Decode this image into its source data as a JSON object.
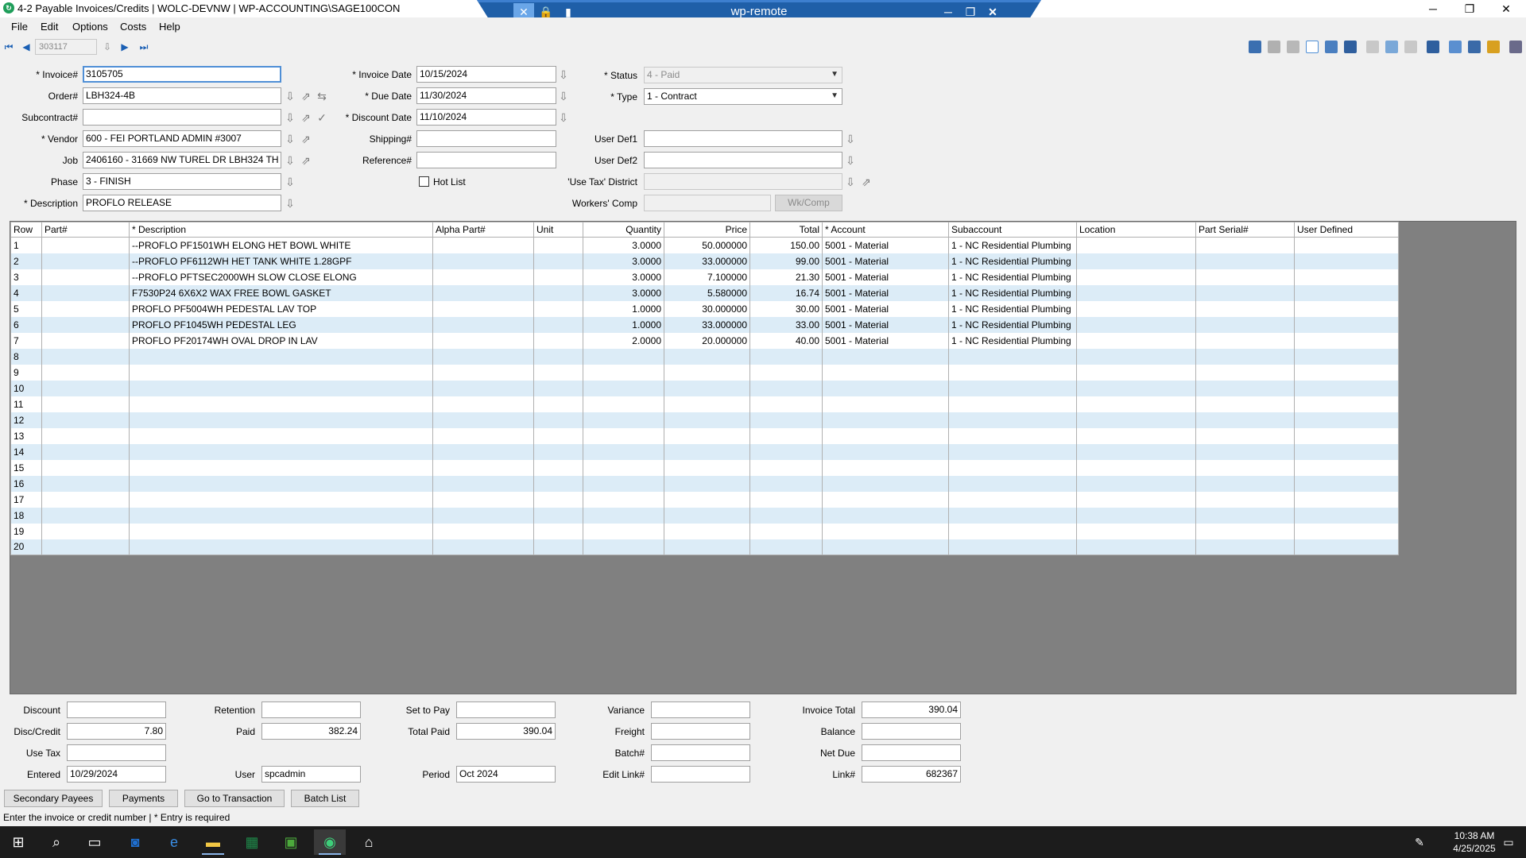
{
  "window": {
    "title": "4-2 Payable Invoices/Credits | WOLC-DEVNW | WP-ACCOUNTING\\SAGE100CON",
    "remote_title": "wp-remote"
  },
  "menu": {
    "file": "File",
    "edit": "Edit",
    "options": "Options",
    "costs": "Costs",
    "help": "Help"
  },
  "nav": {
    "record_number": "303117"
  },
  "form": {
    "invoice_label": "* Invoice#",
    "invoice_value": "3105705",
    "order_label": "Order#",
    "order_value": "LBH324-4B",
    "subcontract_label": "Subcontract#",
    "subcontract_value": "",
    "vendor_label": "* Vendor",
    "vendor_value": "600 - FEI PORTLAND ADMIN #3007",
    "job_label": "Job",
    "job_value": "2406160 - 31669 NW TUREL DR  LBH324 TH",
    "phase_label": "Phase",
    "phase_value": "3 - FINISH",
    "description_label": "* Description",
    "description_value": "PROFLO RELEASE",
    "invoice_date_label": "* Invoice Date",
    "invoice_date_value": "10/15/2024",
    "due_date_label": "* Due Date",
    "due_date_value": "11/30/2024",
    "discount_date_label": "* Discount Date",
    "discount_date_value": "11/10/2024",
    "shipping_label": "Shipping#",
    "shipping_value": "",
    "reference_label": "Reference#",
    "reference_value": "",
    "hot_list_label": "Hot List",
    "status_label": "* Status",
    "status_value": "4 - Paid",
    "type_label": "* Type",
    "type_value": "1 - Contract",
    "user_def1_label": "User Def1",
    "user_def1_value": "",
    "user_def2_label": "User Def2",
    "user_def2_value": "",
    "use_tax_district_label": "'Use Tax' District",
    "use_tax_district_value": "",
    "workers_comp_label": "Workers' Comp",
    "workers_comp_value": "",
    "wk_comp_button": "Wk/Comp"
  },
  "grid": {
    "headers": [
      "Row",
      "Part#",
      "* Description",
      "Alpha Part#",
      "Unit",
      "Quantity",
      "Price",
      "Total",
      "* Account",
      "Subaccount",
      "Location",
      "Part Serial#",
      "User Defined"
    ],
    "rows": [
      [
        "1",
        "",
        "--PROFLO PF1501WH ELONG HET BOWL WHITE",
        "",
        "",
        "3.0000",
        "50.000000",
        "150.00",
        "5001 - Material",
        "1 - NC Residential Plumbing",
        "",
        "",
        ""
      ],
      [
        "2",
        "",
        "--PROFLO PF6112WH HET TANK WHITE 1.28GPF",
        "",
        "",
        "3.0000",
        "33.000000",
        "99.00",
        "5001 - Material",
        "1 - NC Residential Plumbing",
        "",
        "",
        ""
      ],
      [
        "3",
        "",
        "--PROFLO PFTSEC2000WH SLOW CLOSE ELONG",
        "",
        "",
        "3.0000",
        "7.100000",
        "21.30",
        "5001 - Material",
        "1 - NC Residential Plumbing",
        "",
        "",
        ""
      ],
      [
        "4",
        "",
        "F7530P24 6X6X2 WAX FREE BOWL GASKET",
        "",
        "",
        "3.0000",
        "5.580000",
        "16.74",
        "5001 - Material",
        "1 - NC Residential Plumbing",
        "",
        "",
        ""
      ],
      [
        "5",
        "",
        "PROFLO PF5004WH PEDESTAL LAV TOP",
        "",
        "",
        "1.0000",
        "30.000000",
        "30.00",
        "5001 - Material",
        "1 - NC Residential Plumbing",
        "",
        "",
        ""
      ],
      [
        "6",
        "",
        "PROFLO PF1045WH PEDESTAL LEG",
        "",
        "",
        "1.0000",
        "33.000000",
        "33.00",
        "5001 - Material",
        "1 - NC Residential Plumbing",
        "",
        "",
        ""
      ],
      [
        "7",
        "",
        "PROFLO PF20174WH OVAL DROP IN LAV",
        "",
        "",
        "2.0000",
        "20.000000",
        "40.00",
        "5001 - Material",
        "1 - NC Residential Plumbing",
        "",
        "",
        ""
      ],
      [
        "8",
        "",
        "",
        "",
        "",
        "",
        "",
        "",
        "",
        "",
        "",
        "",
        ""
      ],
      [
        "9",
        "",
        "",
        "",
        "",
        "",
        "",
        "",
        "",
        "",
        "",
        "",
        ""
      ],
      [
        "10",
        "",
        "",
        "",
        "",
        "",
        "",
        "",
        "",
        "",
        "",
        "",
        ""
      ],
      [
        "11",
        "",
        "",
        "",
        "",
        "",
        "",
        "",
        "",
        "",
        "",
        "",
        ""
      ],
      [
        "12",
        "",
        "",
        "",
        "",
        "",
        "",
        "",
        "",
        "",
        "",
        "",
        ""
      ],
      [
        "13",
        "",
        "",
        "",
        "",
        "",
        "",
        "",
        "",
        "",
        "",
        "",
        ""
      ],
      [
        "14",
        "",
        "",
        "",
        "",
        "",
        "",
        "",
        "",
        "",
        "",
        "",
        ""
      ],
      [
        "15",
        "",
        "",
        "",
        "",
        "",
        "",
        "",
        "",
        "",
        "",
        "",
        ""
      ],
      [
        "16",
        "",
        "",
        "",
        "",
        "",
        "",
        "",
        "",
        "",
        "",
        "",
        ""
      ],
      [
        "17",
        "",
        "",
        "",
        "",
        "",
        "",
        "",
        "",
        "",
        "",
        "",
        ""
      ],
      [
        "18",
        "",
        "",
        "",
        "",
        "",
        "",
        "",
        "",
        "",
        "",
        "",
        ""
      ],
      [
        "19",
        "",
        "",
        "",
        "",
        "",
        "",
        "",
        "",
        "",
        "",
        "",
        ""
      ],
      [
        "20",
        "",
        "",
        "",
        "",
        "",
        "",
        "",
        "",
        "",
        "",
        "",
        ""
      ]
    ]
  },
  "totals": {
    "discount_label": "Discount",
    "discount_value": "",
    "disc_credit_label": "Disc/Credit",
    "disc_credit_value": "7.80",
    "use_tax_label": "Use Tax",
    "use_tax_value": "",
    "entered_label": "Entered",
    "entered_value": "10/29/2024",
    "retention_label": "Retention",
    "retention_value": "",
    "paid_label": "Paid",
    "paid_value": "382.24",
    "user_label": "User",
    "user_value": "spcadmin",
    "set_to_pay_label": "Set to Pay",
    "set_to_pay_value": "",
    "total_paid_label": "Total Paid",
    "total_paid_value": "390.04",
    "period_label": "Period",
    "period_value": "Oct 2024",
    "variance_label": "Variance",
    "variance_value": "",
    "freight_label": "Freight",
    "freight_value": "",
    "batch_label": "Batch#",
    "batch_value": "",
    "edit_link_label": "Edit Link#",
    "edit_link_value": "",
    "invoice_total_label": "Invoice Total",
    "invoice_total_value": "390.04",
    "balance_label": "Balance",
    "balance_value": "",
    "net_due_label": "Net Due",
    "net_due_value": "",
    "link_label": "Link#",
    "link_value": "682367"
  },
  "buttons": {
    "secondary_payees": "Secondary Payees",
    "payments": "Payments",
    "go_to_transaction": "Go to Transaction",
    "batch_list": "Batch List"
  },
  "status": {
    "text": "Enter the invoice or credit number  |  * Entry is required"
  },
  "taskbar": {
    "time": "10:38 AM",
    "date": "4/25/2025"
  },
  "colors": {
    "remote_bar": "#1f5fa8",
    "grid_background": "#808080",
    "row_alt": "#dcecf7",
    "focus_border": "#4f8fd6",
    "taskbar": "#1c1c1c"
  }
}
